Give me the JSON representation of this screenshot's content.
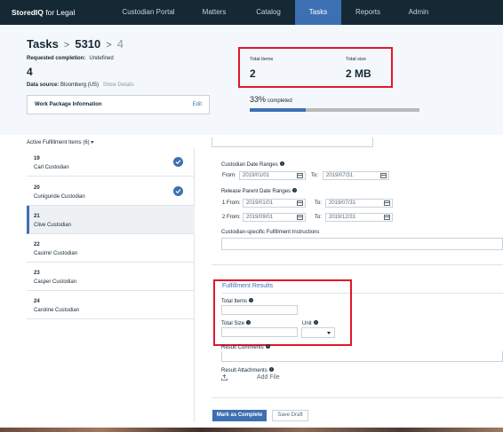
{
  "brand": {
    "strong": "StoredIQ",
    "rest": " for Legal"
  },
  "nav": {
    "items": [
      "Custodian Portal",
      "Matters",
      "Catalog",
      "Tasks",
      "Reports",
      "Admin"
    ],
    "active": "Tasks"
  },
  "breadcrumb": {
    "root": "Tasks",
    "sep1": ">",
    "task": "5310",
    "sep2": ">",
    "current": "4"
  },
  "requested_completion": {
    "label": "Requested completion:",
    "value": "Undefined"
  },
  "big_number": "4",
  "data_source": {
    "label": "Data source:",
    "value": "Bloomberg (US)",
    "link": "Show Details"
  },
  "work_package": {
    "title": "Work Package Information",
    "edit": "Edit"
  },
  "totals": {
    "items_label": "Total items",
    "items_value": "2",
    "size_label": "Total size",
    "size_value": "2 MB"
  },
  "progress": {
    "percent_text": "33%",
    "suffix": "completed",
    "fraction": 0.33
  },
  "active_items": {
    "header": "Active Fulfillment Items (6)",
    "items": [
      {
        "num": "19",
        "name": "Carl Custodian",
        "done": true
      },
      {
        "num": "20",
        "name": "Cunigunde Custodian",
        "done": true
      },
      {
        "num": "21",
        "name": "Clive Custodian",
        "selected": true
      },
      {
        "num": "22",
        "name": "Casimir Custodian"
      },
      {
        "num": "23",
        "name": "Casper Custodian"
      },
      {
        "num": "24",
        "name": "Caroline Custodian"
      }
    ]
  },
  "form": {
    "custodian_date_ranges": "Custodian Date Ranges",
    "release_parent_date_ranges": "Release Parent Date Ranges",
    "from": "From:",
    "to": "To:",
    "one_from": "1 From:",
    "two_from": "2 From:",
    "cd_from": "2019/01/01",
    "cd_to": "2019/07/31",
    "r1_from": "2019/01/01",
    "r1_to": "2019/07/31",
    "r2_from": "2019/09/01",
    "r2_to": "2019/12/31",
    "instructions": "Custodian-specific Fulfillment Instructions",
    "fulfillment_results": "Fulfillment Results",
    "total_items": "Total Items",
    "total_size": "Total Size",
    "unit": "Unit",
    "result_comments": "Result Comments",
    "result_attachments": "Result Attachments",
    "add_file": "Add File",
    "info_glyph": "?"
  },
  "buttons": {
    "mark_complete": "Mark as Complete",
    "save_draft": "Save Draft"
  },
  "colors": {
    "nav_bg": "#152935",
    "accent": "#3d70b2",
    "highlight_red": "#e0182d",
    "header_bg": "#f4f7fb"
  }
}
